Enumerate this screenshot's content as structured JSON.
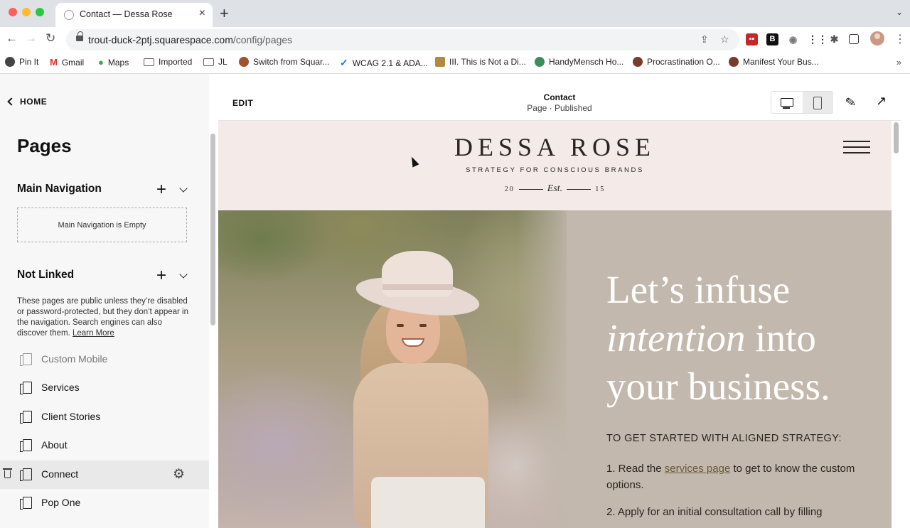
{
  "browser": {
    "tab_title": "Contact — Dessa Rose",
    "url_host": "trout-duck-2ptj.squarespace.com",
    "url_path": "/config/pages",
    "bookmarks": [
      {
        "label": "Pin It",
        "icon": "pin-icon",
        "color": "#444444"
      },
      {
        "label": "Gmail",
        "icon": "gmail-icon",
        "color": "#d93025"
      },
      {
        "label": "Maps",
        "icon": "maps-icon",
        "color": "#34a853"
      },
      {
        "label": "Imported",
        "icon": "folder-icon",
        "color": "#5f6368"
      },
      {
        "label": "JL",
        "icon": "folder-icon",
        "color": "#5f6368"
      },
      {
        "label": "Switch from Squar...",
        "icon": "site-icon",
        "color": "#a0522d"
      },
      {
        "label": "WCAG 2.1 & ADA...",
        "icon": "check-icon",
        "color": "#1a73e8"
      },
      {
        "label": "III. This is Not a Di...",
        "icon": "site-icon",
        "color": "#b08a3e"
      },
      {
        "label": "HandyMensch Ho...",
        "icon": "globe-icon",
        "color": "#3c8d5a"
      },
      {
        "label": "Procrastination O...",
        "icon": "site-icon",
        "color": "#7a3b2a"
      },
      {
        "label": "Manifest Your Bus...",
        "icon": "site-icon",
        "color": "#7a3b2a"
      }
    ]
  },
  "sidebar": {
    "home_label": "HOME",
    "title": "Pages",
    "main_nav": {
      "title": "Main Navigation",
      "empty_text": "Main Navigation is Empty"
    },
    "not_linked": {
      "title": "Not Linked",
      "description": "These pages are public unless they’re disabled or password-protected, but they don’t appear in the navigation. Search engines can also discover them.",
      "learn_more": "Learn More"
    },
    "pages": [
      {
        "label": "Custom Mobile"
      },
      {
        "label": "Services"
      },
      {
        "label": "Client Stories"
      },
      {
        "label": "About"
      },
      {
        "label": "Connect"
      },
      {
        "label": "Pop One"
      }
    ]
  },
  "editor": {
    "edit_label": "EDIT",
    "page_name": "Contact",
    "page_status": "Page · Published"
  },
  "site": {
    "logo": "DESSA ROSE",
    "tagline": "STRATEGY FOR CONSCIOUS BRANDS",
    "est_left": "20",
    "est_script": "Est.",
    "est_right": "15",
    "hero_line1": "Let’s infuse",
    "hero_line2_italic": "intention",
    "hero_line2_rest": " into",
    "hero_line3": "your business.",
    "subheading": "TO GET STARTED WITH ALIGNED STRATEGY:",
    "step1_pre": "1. Read the ",
    "step1_link": "services page",
    "step1_post": " to get to know the custom options.",
    "step2": "2. Apply for an initial consultation call by filling"
  },
  "colors": {
    "header_bg": "#f4ebe8",
    "hero_bg": "#c2b8ad",
    "panel_bg": "#f7f7f7"
  }
}
